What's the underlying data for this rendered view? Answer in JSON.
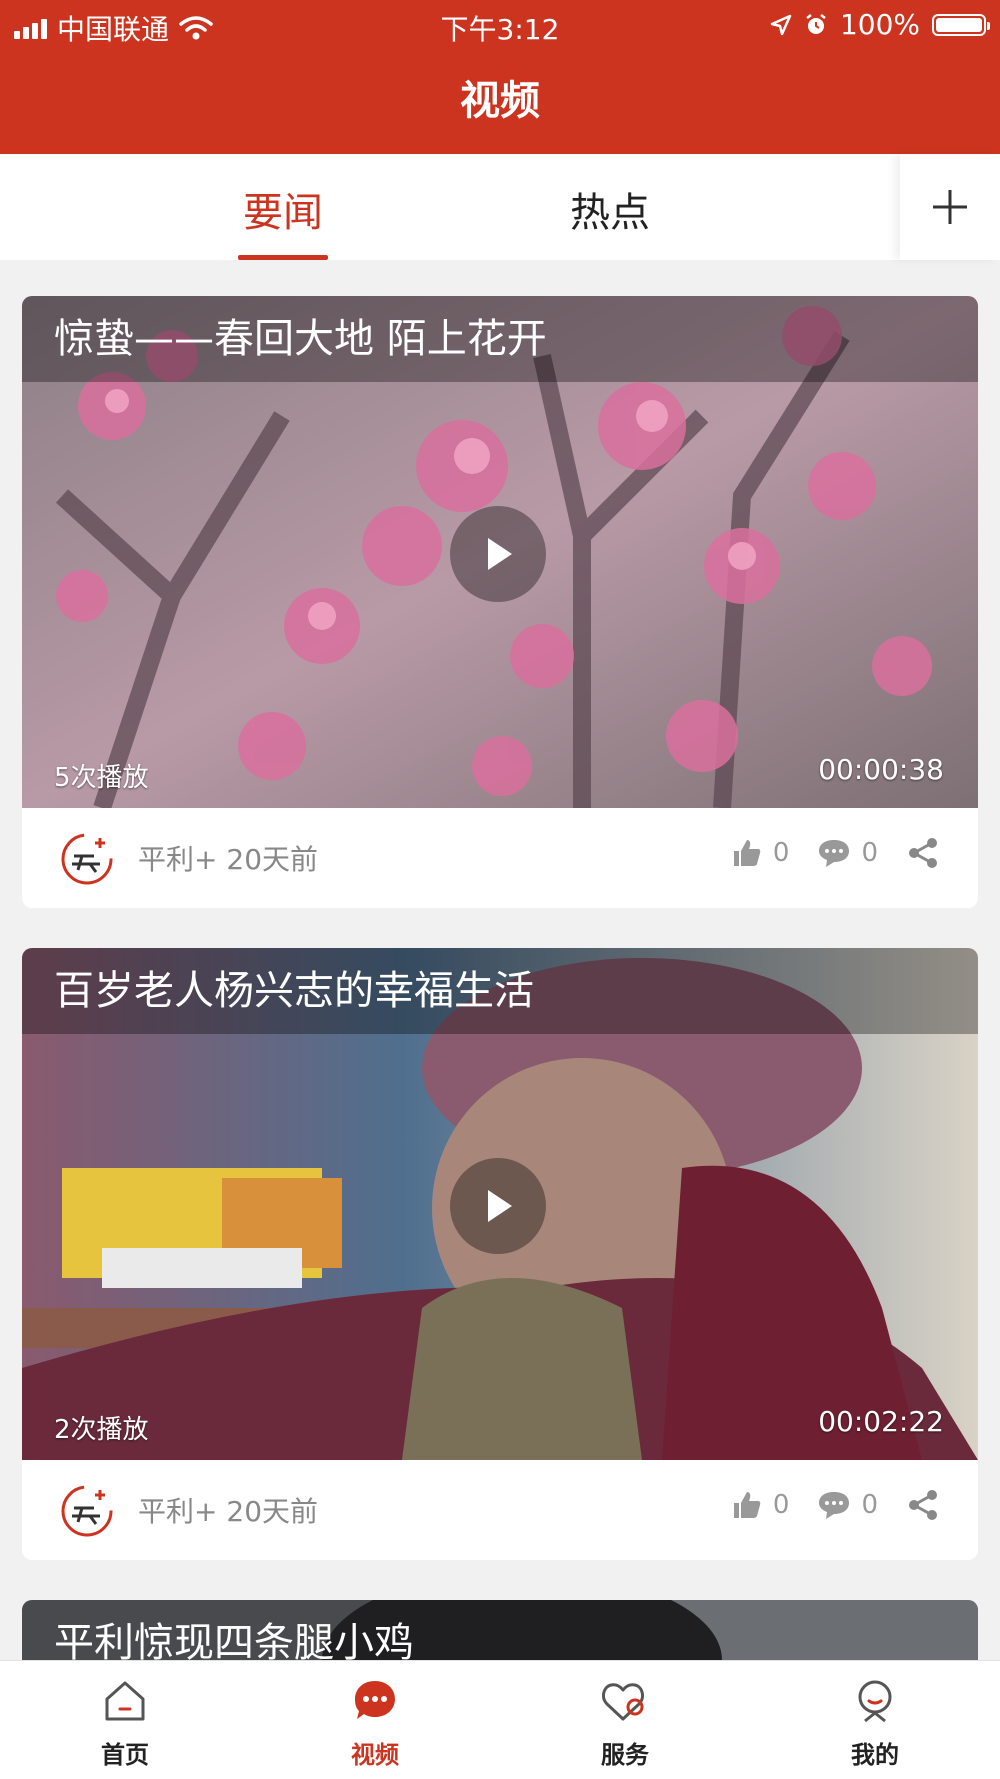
{
  "status_bar": {
    "carrier": "中国联通",
    "time": "下午3:12",
    "battery": "100%"
  },
  "header": {
    "title": "视频"
  },
  "tabs": [
    {
      "label": "要闻",
      "active": true
    },
    {
      "label": "热点",
      "active": false
    }
  ],
  "add_channel_icon": "plus-icon",
  "videos": [
    {
      "title": "惊蛰——春回大地 陌上花开",
      "plays": "5次播放",
      "duration": "00:00:38",
      "source": "平利+",
      "time_ago": "20天前",
      "likes": "0",
      "comments": "0"
    },
    {
      "title": "百岁老人杨兴志的幸福生活",
      "plays": "2次播放",
      "duration": "00:02:22",
      "source": "平利+",
      "time_ago": "20天前",
      "likes": "0",
      "comments": "0"
    },
    {
      "title": "平利惊现四条腿小鸡"
    }
  ],
  "bottom_nav": [
    {
      "label": "首页",
      "icon": "home-icon",
      "active": false
    },
    {
      "label": "视频",
      "icon": "video-chat-icon",
      "active": true
    },
    {
      "label": "服务",
      "icon": "heart-service-icon",
      "active": false
    },
    {
      "label": "我的",
      "icon": "profile-icon",
      "active": false
    }
  ],
  "colors": {
    "brand": "#cc3420",
    "background": "#f1f1f1",
    "muted_text": "#888888"
  }
}
